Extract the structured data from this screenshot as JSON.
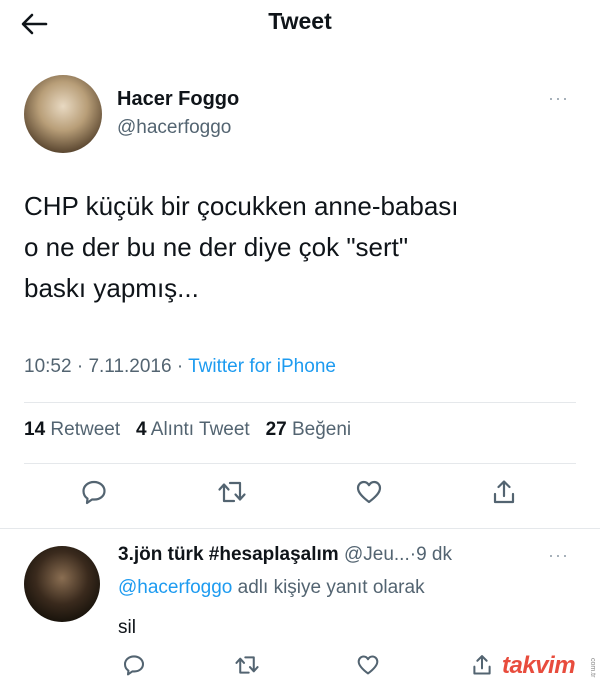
{
  "header": {
    "title": "Tweet",
    "back_icon": "arrow-left-icon"
  },
  "tweet": {
    "author_name": "Hacer Foggo",
    "author_handle": "@hacerfoggo",
    "more_label": "···",
    "text_lines": [
      "CHP küçük bir çocukken anne-babası",
      "o ne der bu ne der diye çok \"sert\"",
      "baskı yapmış..."
    ],
    "time": "10:52",
    "date": "7.11.2016",
    "separator": "·",
    "source": "Twitter for iPhone",
    "stats": {
      "retweets": "14",
      "retweets_label": "Retweet",
      "quotes": "4",
      "quotes_label": "Alıntı Tweet",
      "likes": "27",
      "likes_label": "Beğeni"
    },
    "actions": [
      "comment-icon",
      "retweet-icon",
      "heart-icon",
      "share-icon"
    ]
  },
  "reply": {
    "author_name": "3.jön türk #hesaplaşalım",
    "author_handle": "@Jeu...",
    "separator": "·",
    "time": "9 dk",
    "more_label": "···",
    "reply_to_handle": "@hacerfoggo",
    "reply_to_text": "adlı kişiye yanıt olarak",
    "text": "sil",
    "actions": [
      "comment-icon",
      "retweet-icon",
      "heart-icon",
      "share-icon"
    ]
  },
  "watermark": {
    "text": "takvim",
    "small": "com.tr"
  },
  "colors": {
    "accent": "#1d9bf0",
    "muted": "#536471",
    "text": "#0f1419",
    "divider": "#e5e8eb",
    "watermark": "#e84c3d"
  }
}
